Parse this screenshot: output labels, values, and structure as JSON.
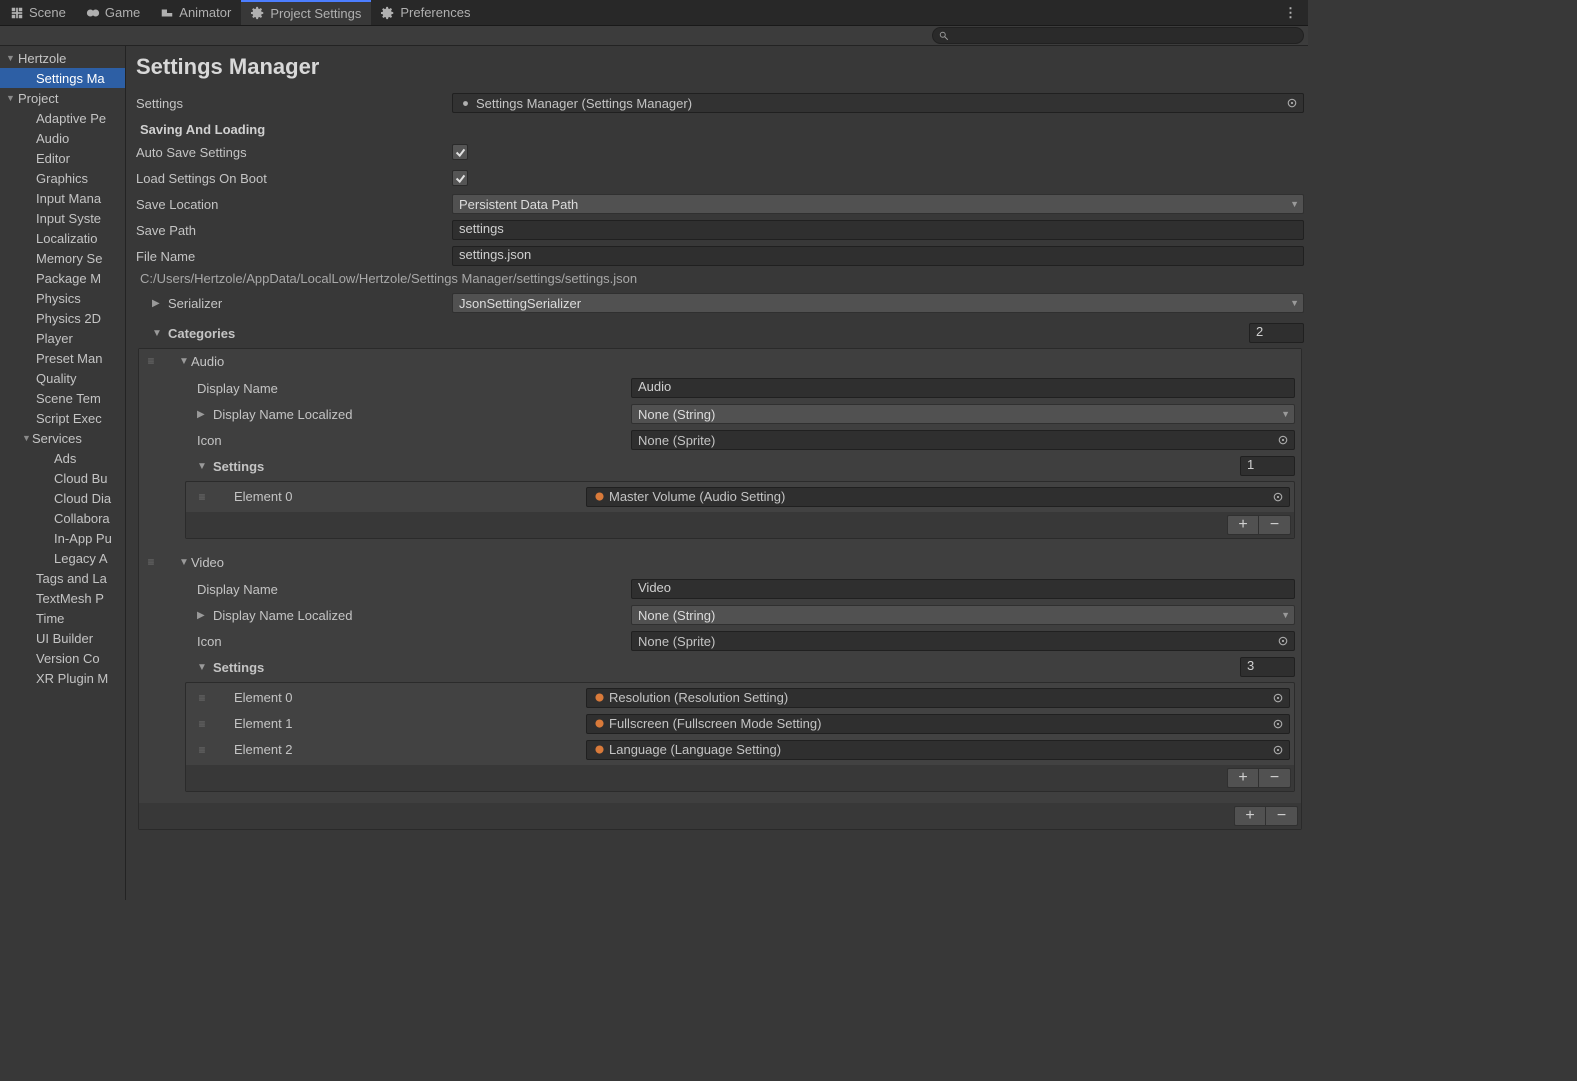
{
  "tabs": [
    {
      "label": "Scene",
      "icon": "scene"
    },
    {
      "label": "Game",
      "icon": "game"
    },
    {
      "label": "Animator",
      "icon": "animator"
    },
    {
      "label": "Project Settings",
      "icon": "gear",
      "active": true
    },
    {
      "label": "Preferences",
      "icon": "gear"
    }
  ],
  "sidebar": {
    "hertzole": "Hertzole",
    "settings_manager": "Settings Ma",
    "project": "Project",
    "project_items": [
      "Adaptive Pe",
      "Audio",
      "Editor",
      "Graphics",
      "Input Mana",
      "Input Syste",
      "Localizatio",
      "Memory Se",
      "Package M",
      "Physics",
      "Physics 2D",
      "Player",
      "Preset Man",
      "Quality",
      "Scene Tem",
      "Script Exec"
    ],
    "services": "Services",
    "services_items": [
      "Ads",
      "Cloud Bu",
      "Cloud Dia",
      "Collabora",
      "In-App Pu",
      "Legacy A"
    ],
    "tail_items": [
      "Tags and La",
      "TextMesh P",
      "Time",
      "UI Builder",
      "Version Co",
      "XR Plugin M"
    ]
  },
  "page": {
    "title": "Settings Manager",
    "settings_label": "Settings",
    "settings_value": "Settings Manager (Settings Manager)",
    "saving_header": "Saving And Loading",
    "auto_save": "Auto Save Settings",
    "load_boot": "Load Settings On Boot",
    "save_loc_label": "Save Location",
    "save_loc_value": "Persistent Data Path",
    "save_path_label": "Save Path",
    "save_path_value": "settings",
    "file_name_label": "File Name",
    "file_name_value": "settings.json",
    "resolved_path": "C:/Users/Hertzole/AppData/LocalLow/Hertzole/Settings Manager/settings/settings.json",
    "serializer_label": "Serializer",
    "serializer_value": "JsonSettingSerializer",
    "categories_label": "Categories",
    "categories_count": "2"
  },
  "cat_audio": {
    "name": "Audio",
    "display_name_label": "Display Name",
    "display_name_value": "Audio",
    "display_name_loc_label": "Display Name Localized",
    "display_name_loc_value": "None (String)",
    "icon_label": "Icon",
    "icon_value": "None (Sprite)",
    "settings_label": "Settings",
    "settings_count": "1",
    "elem0_label": "Element 0",
    "elem0_value": "Master Volume (Audio Setting)"
  },
  "cat_video": {
    "name": "Video",
    "display_name_label": "Display Name",
    "display_name_value": "Video",
    "display_name_loc_label": "Display Name Localized",
    "display_name_loc_value": "None (String)",
    "icon_label": "Icon",
    "icon_value": "None (Sprite)",
    "settings_label": "Settings",
    "settings_count": "3",
    "elem0_label": "Element 0",
    "elem0_value": "Resolution (Resolution Setting)",
    "elem1_label": "Element 1",
    "elem1_value": "Fullscreen (Fullscreen Mode Setting)",
    "elem2_label": "Element 2",
    "elem2_value": "Language (Language Setting)"
  }
}
